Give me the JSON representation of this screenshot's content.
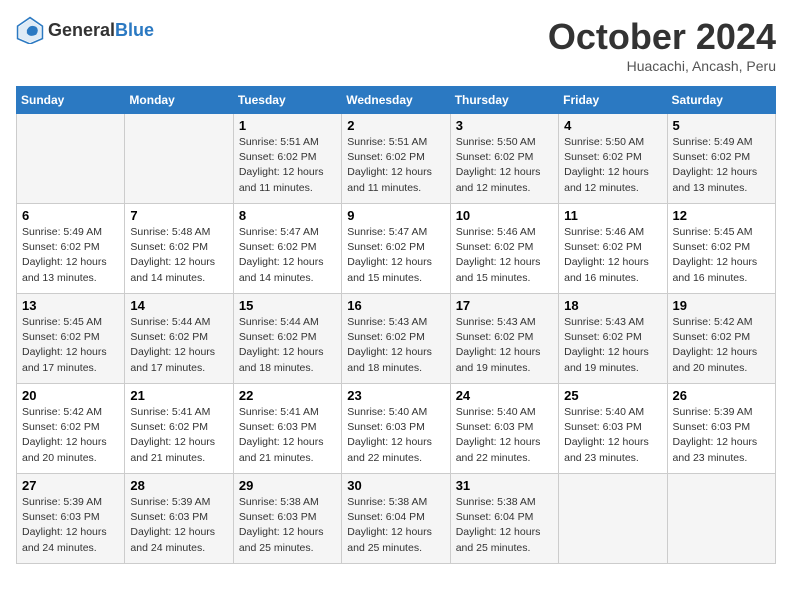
{
  "header": {
    "logo_general": "General",
    "logo_blue": "Blue",
    "title": "October 2024",
    "subtitle": "Huacachi, Ancash, Peru"
  },
  "weekdays": [
    "Sunday",
    "Monday",
    "Tuesday",
    "Wednesday",
    "Thursday",
    "Friday",
    "Saturday"
  ],
  "weeks": [
    [
      {
        "day": "",
        "sunrise": "",
        "sunset": "",
        "daylight": ""
      },
      {
        "day": "",
        "sunrise": "",
        "sunset": "",
        "daylight": ""
      },
      {
        "day": "1",
        "sunrise": "Sunrise: 5:51 AM",
        "sunset": "Sunset: 6:02 PM",
        "daylight": "Daylight: 12 hours and 11 minutes."
      },
      {
        "day": "2",
        "sunrise": "Sunrise: 5:51 AM",
        "sunset": "Sunset: 6:02 PM",
        "daylight": "Daylight: 12 hours and 11 minutes."
      },
      {
        "day": "3",
        "sunrise": "Sunrise: 5:50 AM",
        "sunset": "Sunset: 6:02 PM",
        "daylight": "Daylight: 12 hours and 12 minutes."
      },
      {
        "day": "4",
        "sunrise": "Sunrise: 5:50 AM",
        "sunset": "Sunset: 6:02 PM",
        "daylight": "Daylight: 12 hours and 12 minutes."
      },
      {
        "day": "5",
        "sunrise": "Sunrise: 5:49 AM",
        "sunset": "Sunset: 6:02 PM",
        "daylight": "Daylight: 12 hours and 13 minutes."
      }
    ],
    [
      {
        "day": "6",
        "sunrise": "Sunrise: 5:49 AM",
        "sunset": "Sunset: 6:02 PM",
        "daylight": "Daylight: 12 hours and 13 minutes."
      },
      {
        "day": "7",
        "sunrise": "Sunrise: 5:48 AM",
        "sunset": "Sunset: 6:02 PM",
        "daylight": "Daylight: 12 hours and 14 minutes."
      },
      {
        "day": "8",
        "sunrise": "Sunrise: 5:47 AM",
        "sunset": "Sunset: 6:02 PM",
        "daylight": "Daylight: 12 hours and 14 minutes."
      },
      {
        "day": "9",
        "sunrise": "Sunrise: 5:47 AM",
        "sunset": "Sunset: 6:02 PM",
        "daylight": "Daylight: 12 hours and 15 minutes."
      },
      {
        "day": "10",
        "sunrise": "Sunrise: 5:46 AM",
        "sunset": "Sunset: 6:02 PM",
        "daylight": "Daylight: 12 hours and 15 minutes."
      },
      {
        "day": "11",
        "sunrise": "Sunrise: 5:46 AM",
        "sunset": "Sunset: 6:02 PM",
        "daylight": "Daylight: 12 hours and 16 minutes."
      },
      {
        "day": "12",
        "sunrise": "Sunrise: 5:45 AM",
        "sunset": "Sunset: 6:02 PM",
        "daylight": "Daylight: 12 hours and 16 minutes."
      }
    ],
    [
      {
        "day": "13",
        "sunrise": "Sunrise: 5:45 AM",
        "sunset": "Sunset: 6:02 PM",
        "daylight": "Daylight: 12 hours and 17 minutes."
      },
      {
        "day": "14",
        "sunrise": "Sunrise: 5:44 AM",
        "sunset": "Sunset: 6:02 PM",
        "daylight": "Daylight: 12 hours and 17 minutes."
      },
      {
        "day": "15",
        "sunrise": "Sunrise: 5:44 AM",
        "sunset": "Sunset: 6:02 PM",
        "daylight": "Daylight: 12 hours and 18 minutes."
      },
      {
        "day": "16",
        "sunrise": "Sunrise: 5:43 AM",
        "sunset": "Sunset: 6:02 PM",
        "daylight": "Daylight: 12 hours and 18 minutes."
      },
      {
        "day": "17",
        "sunrise": "Sunrise: 5:43 AM",
        "sunset": "Sunset: 6:02 PM",
        "daylight": "Daylight: 12 hours and 19 minutes."
      },
      {
        "day": "18",
        "sunrise": "Sunrise: 5:43 AM",
        "sunset": "Sunset: 6:02 PM",
        "daylight": "Daylight: 12 hours and 19 minutes."
      },
      {
        "day": "19",
        "sunrise": "Sunrise: 5:42 AM",
        "sunset": "Sunset: 6:02 PM",
        "daylight": "Daylight: 12 hours and 20 minutes."
      }
    ],
    [
      {
        "day": "20",
        "sunrise": "Sunrise: 5:42 AM",
        "sunset": "Sunset: 6:02 PM",
        "daylight": "Daylight: 12 hours and 20 minutes."
      },
      {
        "day": "21",
        "sunrise": "Sunrise: 5:41 AM",
        "sunset": "Sunset: 6:02 PM",
        "daylight": "Daylight: 12 hours and 21 minutes."
      },
      {
        "day": "22",
        "sunrise": "Sunrise: 5:41 AM",
        "sunset": "Sunset: 6:03 PM",
        "daylight": "Daylight: 12 hours and 21 minutes."
      },
      {
        "day": "23",
        "sunrise": "Sunrise: 5:40 AM",
        "sunset": "Sunset: 6:03 PM",
        "daylight": "Daylight: 12 hours and 22 minutes."
      },
      {
        "day": "24",
        "sunrise": "Sunrise: 5:40 AM",
        "sunset": "Sunset: 6:03 PM",
        "daylight": "Daylight: 12 hours and 22 minutes."
      },
      {
        "day": "25",
        "sunrise": "Sunrise: 5:40 AM",
        "sunset": "Sunset: 6:03 PM",
        "daylight": "Daylight: 12 hours and 23 minutes."
      },
      {
        "day": "26",
        "sunrise": "Sunrise: 5:39 AM",
        "sunset": "Sunset: 6:03 PM",
        "daylight": "Daylight: 12 hours and 23 minutes."
      }
    ],
    [
      {
        "day": "27",
        "sunrise": "Sunrise: 5:39 AM",
        "sunset": "Sunset: 6:03 PM",
        "daylight": "Daylight: 12 hours and 24 minutes."
      },
      {
        "day": "28",
        "sunrise": "Sunrise: 5:39 AM",
        "sunset": "Sunset: 6:03 PM",
        "daylight": "Daylight: 12 hours and 24 minutes."
      },
      {
        "day": "29",
        "sunrise": "Sunrise: 5:38 AM",
        "sunset": "Sunset: 6:03 PM",
        "daylight": "Daylight: 12 hours and 25 minutes."
      },
      {
        "day": "30",
        "sunrise": "Sunrise: 5:38 AM",
        "sunset": "Sunset: 6:04 PM",
        "daylight": "Daylight: 12 hours and 25 minutes."
      },
      {
        "day": "31",
        "sunrise": "Sunrise: 5:38 AM",
        "sunset": "Sunset: 6:04 PM",
        "daylight": "Daylight: 12 hours and 25 minutes."
      },
      {
        "day": "",
        "sunrise": "",
        "sunset": "",
        "daylight": ""
      },
      {
        "day": "",
        "sunrise": "",
        "sunset": "",
        "daylight": ""
      }
    ]
  ]
}
